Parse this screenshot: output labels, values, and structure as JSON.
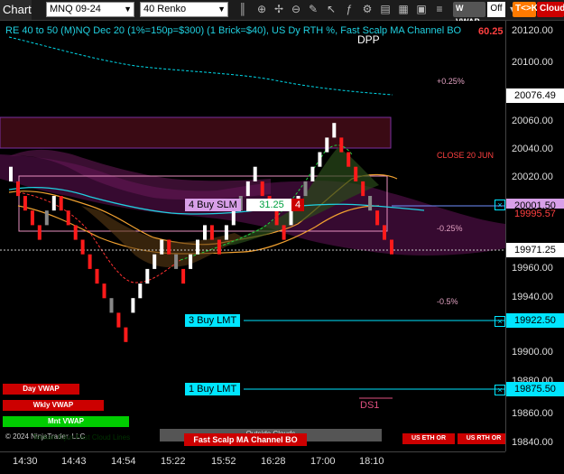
{
  "toolbar": {
    "chart_tab": "Chart",
    "instrument": "MNQ 09-24",
    "bar_type": "40 Renko",
    "vwap_button": "W VWAP",
    "off_toggle": "Off",
    "tk_button": "T<>K",
    "cloud_button": "Cloud"
  },
  "chart": {
    "header_text": "RE 40 to 50 (M)NQ Dec 20 (1%=150p=$300) (1 Brick=$40), US Dy RTH %, Fast Scalp MA Channel BO",
    "header_value": "60.25",
    "dpp_label": "DPP",
    "pct_labels": [
      "+0.25%",
      "CLOSE 20 JUN",
      "-0.25%",
      "-0.5%"
    ],
    "ds1_label": "DS1",
    "copyright": "© 2024 NinjaTrader, LLC",
    "ichimoku_label": "Tenkan Kijun Fast Cloud Lines",
    "outside_clouds": "Outside Clouds",
    "strategy_label": "Fast Scalp MA Channel BO",
    "position_order": {
      "label": "4 Buy SLM",
      "pnl": "31.25",
      "qty": "4"
    },
    "orders": [
      {
        "label": "3 Buy LMT",
        "price": "19922.50"
      },
      {
        "label": "1 Buy LMT",
        "price": "19875.50"
      }
    ],
    "vwap_buttons": [
      "Day VWAP",
      "Wkly VWAP",
      "Mnt VWAP"
    ],
    "session_buttons": [
      "US ETH OR",
      "US RTH OR"
    ],
    "colors": {
      "up": "#ffffff",
      "down": "#ff1a1a",
      "neutral": "#888888",
      "order_line": "#00e5ff",
      "vwap_red": "#cc0000",
      "vwap_green": "#00cc00"
    }
  },
  "price_axis": {
    "ticks": [
      "20120.00",
      "20100.00",
      "20080.00",
      "20060.00",
      "20040.00",
      "20020.00",
      "19980.00",
      "19960.00",
      "19940.00",
      "19900.00",
      "19880.00",
      "19860.00",
      "19840.00"
    ],
    "tags": {
      "resistance": "20076.49",
      "current_upper": "20001.50",
      "current_mid": "19995.57",
      "last": "19971.25",
      "order_a": "19922.50",
      "order_b": "19875.50"
    }
  },
  "time_axis": {
    "ticks": [
      "14:30",
      "14:43",
      "14:54",
      "15:22",
      "15:52",
      "16:28",
      "17:00",
      "18:10"
    ]
  },
  "chart_data": {
    "type": "renko",
    "brick_size_points": 10,
    "bricks": [
      {
        "time": "14:30",
        "open": 20030,
        "close": 20020,
        "dir": "up"
      },
      {
        "time": "14:30",
        "open": 20020,
        "close": 20010,
        "dir": "down"
      },
      {
        "time": "14:33",
        "open": 20010,
        "close": 20000,
        "dir": "down"
      },
      {
        "time": "14:35",
        "open": 20000,
        "close": 19990,
        "dir": "down"
      },
      {
        "time": "14:38",
        "open": 19990,
        "close": 19980,
        "dir": "down"
      },
      {
        "time": "14:40",
        "open": 19990,
        "close": 20000,
        "dir": "up"
      },
      {
        "time": "14:41",
        "open": 20000,
        "close": 20010,
        "dir": "up"
      },
      {
        "time": "14:43",
        "open": 20010,
        "close": 20000,
        "dir": "down"
      },
      {
        "time": "14:44",
        "open": 20000,
        "close": 19990,
        "dir": "down"
      },
      {
        "time": "14:45",
        "open": 19990,
        "close": 19980,
        "dir": "down"
      },
      {
        "time": "14:46",
        "open": 19980,
        "close": 19970,
        "dir": "down"
      },
      {
        "time": "14:47",
        "open": 19970,
        "close": 19960,
        "dir": "down"
      },
      {
        "time": "14:48",
        "open": 19960,
        "close": 19950,
        "dir": "down"
      },
      {
        "time": "14:50",
        "open": 19950,
        "close": 19940,
        "dir": "down"
      },
      {
        "time": "14:51",
        "open": 19940,
        "close": 19930,
        "dir": "down"
      },
      {
        "time": "14:52",
        "open": 19930,
        "close": 19920,
        "dir": "down"
      },
      {
        "time": "14:54",
        "open": 19920,
        "close": 19910,
        "dir": "down"
      },
      {
        "time": "14:56",
        "open": 19930,
        "close": 19940,
        "dir": "up"
      },
      {
        "time": "14:58",
        "open": 19940,
        "close": 19950,
        "dir": "up"
      },
      {
        "time": "15:00",
        "open": 19950,
        "close": 19960,
        "dir": "up"
      },
      {
        "time": "15:03",
        "open": 19960,
        "close": 19970,
        "dir": "up"
      },
      {
        "time": "15:06",
        "open": 19970,
        "close": 19980,
        "dir": "up"
      },
      {
        "time": "15:10",
        "open": 19980,
        "close": 19970,
        "dir": "down"
      },
      {
        "time": "15:14",
        "open": 19970,
        "close": 19960,
        "dir": "down"
      },
      {
        "time": "15:18",
        "open": 19960,
        "close": 19950,
        "dir": "down"
      },
      {
        "time": "15:22",
        "open": 19960,
        "close": 19970,
        "dir": "up"
      },
      {
        "time": "15:27",
        "open": 19970,
        "close": 19980,
        "dir": "up"
      },
      {
        "time": "15:32",
        "open": 19980,
        "close": 19990,
        "dir": "up"
      },
      {
        "time": "15:37",
        "open": 19990,
        "close": 19980,
        "dir": "down"
      },
      {
        "time": "15:42",
        "open": 19980,
        "close": 19970,
        "dir": "down"
      },
      {
        "time": "15:47",
        "open": 19980,
        "close": 19990,
        "dir": "up"
      },
      {
        "time": "15:52",
        "open": 19990,
        "close": 20000,
        "dir": "up"
      },
      {
        "time": "15:57",
        "open": 20000,
        "close": 20010,
        "dir": "up"
      },
      {
        "time": "16:03",
        "open": 20010,
        "close": 20020,
        "dir": "up"
      },
      {
        "time": "16:10",
        "open": 20020,
        "close": 20030,
        "dir": "up"
      },
      {
        "time": "16:18",
        "open": 20020,
        "close": 20010,
        "dir": "down"
      },
      {
        "time": "16:23",
        "open": 20010,
        "close": 20000,
        "dir": "down"
      },
      {
        "time": "16:28",
        "open": 20000,
        "close": 19990,
        "dir": "down"
      },
      {
        "time": "16:33",
        "open": 19990,
        "close": 19980,
        "dir": "down"
      },
      {
        "time": "16:38",
        "open": 19990,
        "close": 20000,
        "dir": "up"
      },
      {
        "time": "16:43",
        "open": 20000,
        "close": 20010,
        "dir": "up"
      },
      {
        "time": "16:48",
        "open": 20010,
        "close": 20020,
        "dir": "up"
      },
      {
        "time": "16:52",
        "open": 20020,
        "close": 20030,
        "dir": "up"
      },
      {
        "time": "16:56",
        "open": 20030,
        "close": 20040,
        "dir": "up"
      },
      {
        "time": "17:00",
        "open": 20040,
        "close": 20050,
        "dir": "up"
      },
      {
        "time": "17:03",
        "open": 20050,
        "close": 20060,
        "dir": "up"
      },
      {
        "time": "17:07",
        "open": 20050,
        "close": 20040,
        "dir": "down"
      },
      {
        "time": "17:15",
        "open": 20040,
        "close": 20030,
        "dir": "down"
      },
      {
        "time": "17:25",
        "open": 20030,
        "close": 20020,
        "dir": "down"
      },
      {
        "time": "17:40",
        "open": 20020,
        "close": 20010,
        "dir": "down"
      },
      {
        "time": "17:55",
        "open": 20010,
        "close": 20000,
        "dir": "down"
      },
      {
        "time": "18:05",
        "open": 20000,
        "close": 19990,
        "dir": "down"
      },
      {
        "time": "18:10",
        "open": 19990,
        "close": 19980,
        "dir": "down"
      },
      {
        "time": "18:15",
        "open": 19980,
        "close": 19970,
        "dir": "down"
      }
    ],
    "yrange": [
      19835,
      20130
    ]
  }
}
